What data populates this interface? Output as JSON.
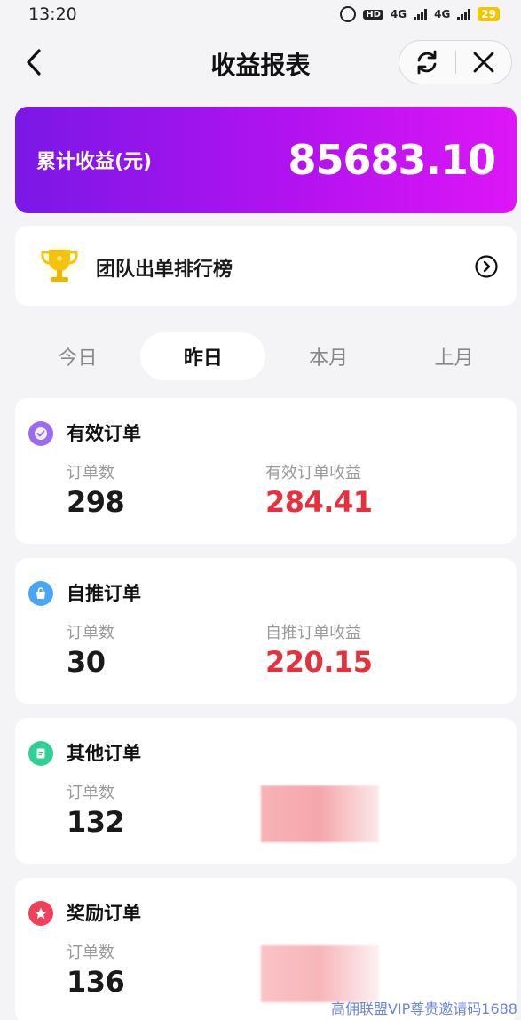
{
  "status_bar": {
    "time": "13:20",
    "network_1": "4G",
    "network_2": "4G",
    "battery": "29"
  },
  "nav": {
    "title": "收益报表"
  },
  "total": {
    "label": "累计收益(元)",
    "value": "85683.10"
  },
  "ranking": {
    "label": "团队出单排行榜"
  },
  "tabs": [
    {
      "label": "今日",
      "active": false
    },
    {
      "label": "昨日",
      "active": true
    },
    {
      "label": "本月",
      "active": false
    },
    {
      "label": "上月",
      "active": false
    }
  ],
  "orders": [
    {
      "title": "有效订单",
      "icon": "check-badge-icon",
      "icon_color": "#9b6cf0",
      "count_label": "订单数",
      "count": "298",
      "income_label": "有效订单收益",
      "income": "284.41"
    },
    {
      "title": "自推订单",
      "icon": "bag-icon",
      "icon_color": "#4aa6f5",
      "count_label": "订单数",
      "count": "30",
      "income_label": "自推订单收益",
      "income": "220.15"
    },
    {
      "title": "其他订单",
      "icon": "document-icon",
      "icon_color": "#2fcf95",
      "count_label": "订单数",
      "count": "132"
    },
    {
      "title": "奖励订单",
      "icon": "star-icon",
      "icon_color": "#f0405a",
      "count_label": "订单数",
      "count": "136"
    }
  ],
  "colors": {
    "accent_gradient_start": "#7a18e6",
    "accent_gradient_end": "#dd16f6",
    "income_red": "#e8303c"
  },
  "watermark": "高佣联盟VIP尊贵邀请码1688"
}
